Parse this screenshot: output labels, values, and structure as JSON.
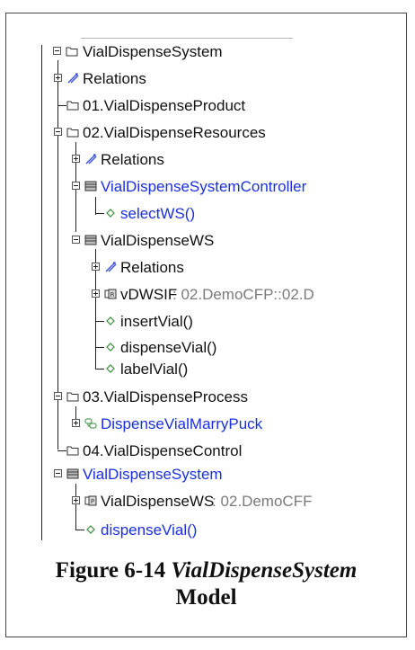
{
  "tree": {
    "root": {
      "label": "VialDispenseSystem",
      "icon": "package-icon"
    },
    "rows": [
      {
        "id": "r1",
        "label": "Relations",
        "icon": "relations-icon"
      },
      {
        "id": "r2",
        "label": "01.VialDispenseProduct",
        "icon": "package-icon"
      },
      {
        "id": "r3",
        "label": "02.VialDispenseResources",
        "icon": "package-icon"
      },
      {
        "id": "r4",
        "label": "Relations",
        "icon": "relations-icon"
      },
      {
        "id": "r5",
        "label": "VialDispenseSystemController",
        "icon": "block-icon",
        "color": "#1a2fe0"
      },
      {
        "id": "r6",
        "label": "selectWS()",
        "icon": "operation-icon",
        "color": "#1a2fe0"
      },
      {
        "id": "r7",
        "label": "VialDispenseWS",
        "icon": "block-icon"
      },
      {
        "id": "r8",
        "label": "Relations",
        "icon": "relations-icon"
      },
      {
        "id": "r9",
        "label": "vDWSIF",
        "type": " : 02.DemoCFP::02.D",
        "icon": "port-icon"
      },
      {
        "id": "r10",
        "label": "insertVial()",
        "icon": "operation-icon"
      },
      {
        "id": "r11",
        "label": "dispenseVial()",
        "icon": "operation-icon"
      },
      {
        "id": "r12",
        "label": "labelVial()",
        "icon": "operation-icon"
      },
      {
        "id": "r13",
        "label": "03.VialDispenseProcess",
        "icon": "package-icon"
      },
      {
        "id": "r14",
        "label": "DispenseVialMarryPuck",
        "icon": "activity-icon",
        "color": "#1a2fe0"
      },
      {
        "id": "r15",
        "label": "04.VialDispenseControl",
        "icon": "package-icon"
      },
      {
        "id": "r16",
        "label": "VialDispenseSystem",
        "icon": "block-icon",
        "color": "#1a2fe0"
      },
      {
        "id": "r17",
        "label": "VialDispenseWS",
        "type": " : 02.DemoCFF",
        "icon": "part-icon"
      },
      {
        "id": "r18",
        "label": "dispenseVial()",
        "icon": "operation-icon",
        "color": "#1a2fe0"
      }
    ]
  },
  "caption": {
    "prefix": "Figure 6-14 ",
    "italic": "VialDispenseSystem",
    "line2": "Model"
  }
}
